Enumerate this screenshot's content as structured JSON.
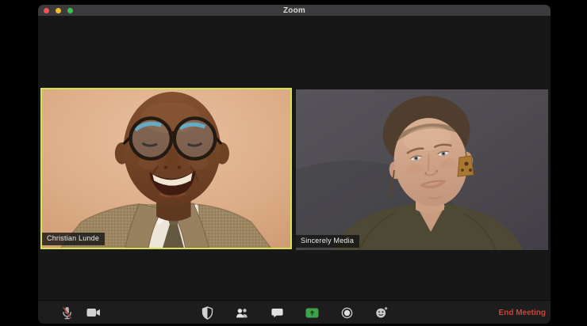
{
  "window": {
    "title": "Zoom"
  },
  "titlebar": {
    "buttons": [
      {
        "name": "close",
        "color": "#f4534e"
      },
      {
        "name": "minimize",
        "color": "#f6b92c"
      },
      {
        "name": "zoom",
        "color": "#33c748"
      }
    ]
  },
  "meeting": {
    "participants": [
      {
        "name": "Christian Lunde",
        "active_speaker": true
      },
      {
        "name": "Sincerely Media",
        "active_speaker": false
      }
    ]
  },
  "toolbar": {
    "buttons": [
      {
        "id": "mute",
        "icon": "microphone-muted-icon",
        "state": "muted"
      },
      {
        "id": "video",
        "icon": "video-camera-icon",
        "state": "on"
      },
      {
        "id": "security",
        "icon": "shield-icon"
      },
      {
        "id": "participants",
        "icon": "participants-icon"
      },
      {
        "id": "chat",
        "icon": "chat-bubble-icon"
      },
      {
        "id": "share-screen",
        "icon": "share-screen-icon"
      },
      {
        "id": "record",
        "icon": "record-icon"
      },
      {
        "id": "reactions",
        "icon": "reactions-smiley-icon"
      }
    ],
    "end_meeting_label": "End Meeting"
  },
  "colors": {
    "active_speaker_border": "#d9e24e",
    "share_screen_green": "#3fa24b",
    "end_meeting_red": "#c4453b",
    "titlebar_bg": "#3b3b3d",
    "toolbar_bg": "#1d1d1e",
    "canvas_bg": "#000000"
  }
}
